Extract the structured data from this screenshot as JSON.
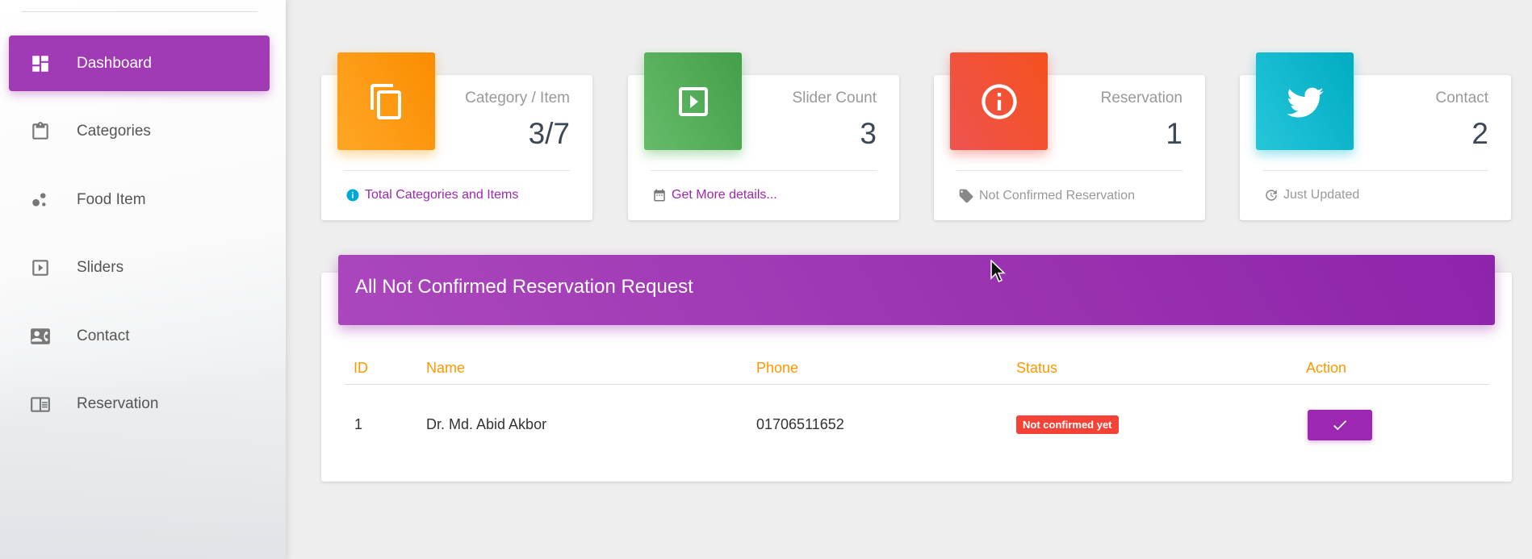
{
  "sidebar": {
    "items": [
      {
        "label": "Dashboard",
        "icon": "dashboard-icon",
        "active": true
      },
      {
        "label": "Categories",
        "icon": "clipboard-icon",
        "active": false
      },
      {
        "label": "Food Item",
        "icon": "bubbles-icon",
        "active": false
      },
      {
        "label": "Sliders",
        "icon": "slideshow-icon",
        "active": false
      },
      {
        "label": "Contact",
        "icon": "contact-card-icon",
        "active": false
      },
      {
        "label": "Reservation",
        "icon": "reservation-icon",
        "active": false
      }
    ]
  },
  "cards": [
    {
      "category": "Category / Item",
      "value": "3/7",
      "footer": "Total Categories and Items",
      "color": "#ff9800",
      "icon": "copy-icon",
      "footer_icon": "info-icon"
    },
    {
      "category": "Slider Count",
      "value": "3",
      "footer": "Get More details...",
      "color": "#4caf50",
      "icon": "slideshow-icon",
      "footer_icon": "calendar-icon"
    },
    {
      "category": "Reservation",
      "value": "1",
      "footer": "Not Confirmed Reservation",
      "color": "#f44336",
      "icon": "info-outline-icon",
      "footer_icon": "tag-icon"
    },
    {
      "category": "Contact",
      "value": "2",
      "footer": "Just Updated",
      "color": "#00bcd4",
      "icon": "twitter-icon",
      "footer_icon": "update-icon"
    }
  ],
  "reservations": {
    "title": "All Not Confirmed Reservation Request",
    "columns": [
      "ID",
      "Name",
      "Phone",
      "Status",
      "Action"
    ],
    "rows": [
      {
        "id": "1",
        "name": "Dr. Md. Abid Akbor",
        "phone": "01706511652",
        "status": "Not confirmed yet"
      }
    ]
  },
  "colors": {
    "primary": "#9c27b0",
    "header_orange": "#ff9800",
    "danger": "#f44336"
  }
}
